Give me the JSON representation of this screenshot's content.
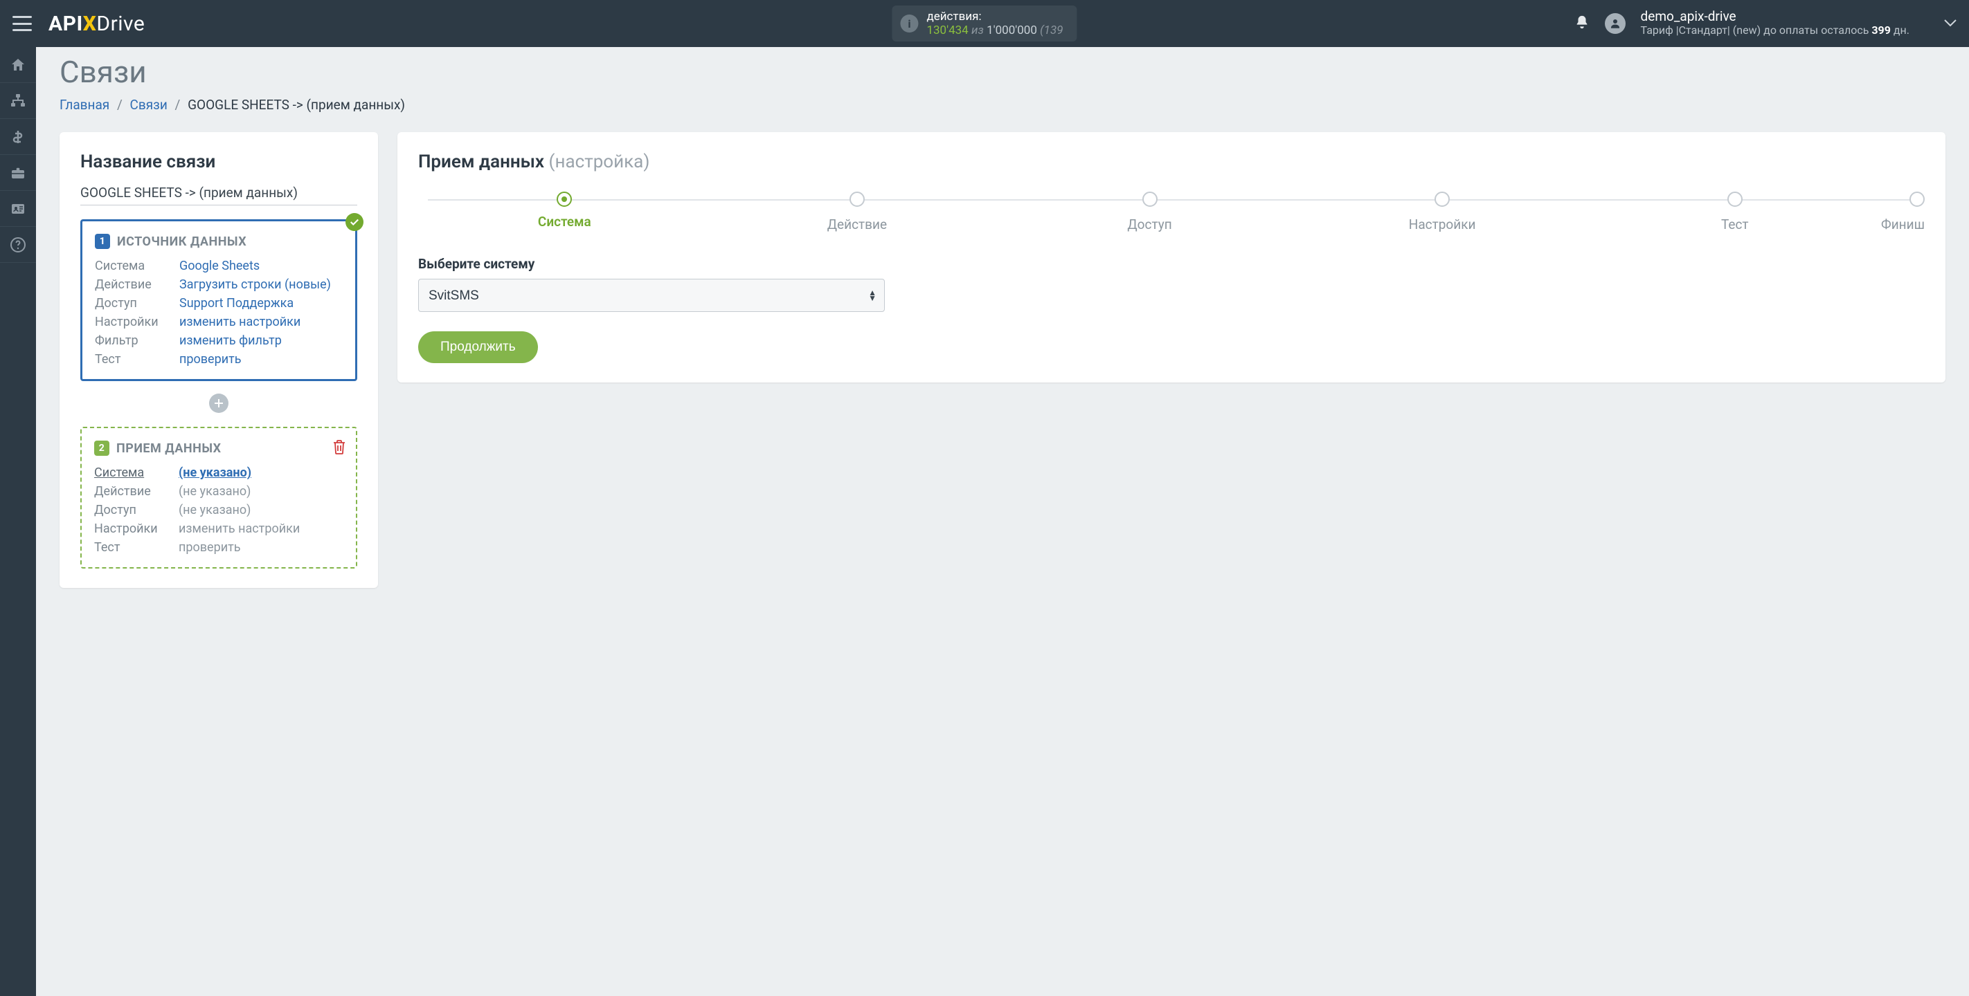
{
  "topbar": {
    "actions_label": "действия:",
    "actions_count": "130'434",
    "actions_of": "из",
    "actions_limit": "1'000'000",
    "actions_extra": "(139",
    "username": "demo_apix-drive",
    "plan_prefix": "Тариф |Стандарт| (new) до оплаты осталось",
    "plan_days": "399",
    "plan_suffix": "дн."
  },
  "page": {
    "title": "Связи",
    "crumb_home": "Главная",
    "crumb_links": "Связи",
    "crumb_current": "GOOGLE SHEETS -> (прием данных)"
  },
  "left": {
    "heading": "Название связи",
    "conn_name": "GOOGLE SHEETS -> (прием данных)",
    "source": {
      "badge": "1",
      "title": "ИСТОЧНИК ДАННЫХ",
      "rows": {
        "system_k": "Система",
        "system_v": "Google Sheets",
        "action_k": "Действие",
        "action_v": "Загрузить строки (новые)",
        "access_k": "Доступ",
        "access_v": "Support Поддержка",
        "settings_k": "Настройки",
        "settings_v": "изменить настройки",
        "filter_k": "Фильтр",
        "filter_v": "изменить фильтр",
        "test_k": "Тест",
        "test_v": "проверить"
      }
    },
    "dest": {
      "badge": "2",
      "title": "ПРИЕМ ДАННЫХ",
      "rows": {
        "system_k": "Система",
        "system_v": "(не указано)",
        "action_k": "Действие",
        "action_v": "(не указано)",
        "access_k": "Доступ",
        "access_v": "(не указано)",
        "settings_k": "Настройки",
        "settings_v": "изменить настройки",
        "test_k": "Тест",
        "test_v": "проверить"
      }
    }
  },
  "right": {
    "heading_main": "Прием данных",
    "heading_sub": "(настройка)",
    "steps": {
      "s1": "Система",
      "s2": "Действие",
      "s3": "Доступ",
      "s4": "Настройки",
      "s5": "Тест",
      "s6": "Финиш"
    },
    "field_label": "Выберите систему",
    "select_value": "SvitSMS",
    "continue": "Продолжить"
  }
}
